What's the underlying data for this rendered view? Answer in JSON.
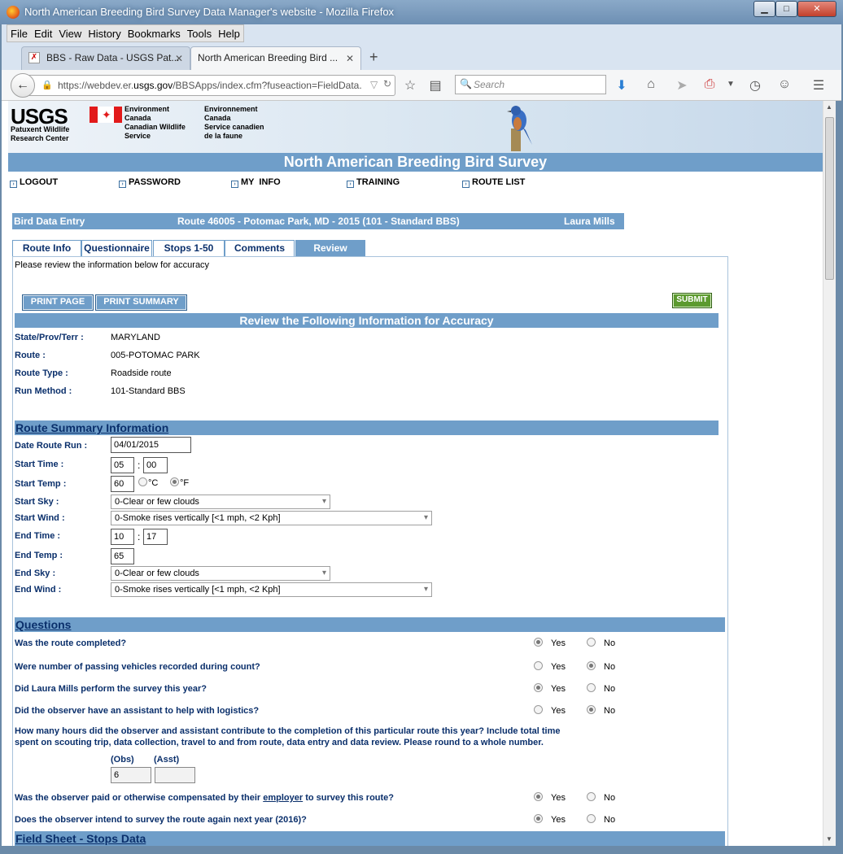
{
  "window": {
    "title": "North American Breeding Bird Survey Data Manager's website - Mozilla Firefox",
    "minimize": "▁",
    "maximize": "□",
    "close": "✕"
  },
  "menu": [
    "File",
    "Edit",
    "View",
    "History",
    "Bookmarks",
    "Tools",
    "Help"
  ],
  "tabs": [
    {
      "label": "BBS - Raw Data - USGS Pat...",
      "close": "✕"
    },
    {
      "label": "North American Breeding Bird ...",
      "close": "✕"
    }
  ],
  "new_tab": "+",
  "nav": {
    "url_prefix": "https://webdev.er.",
    "url_domain": "usgs.gov",
    "url_rest": "/BBSApps/index.cfm?fuseaction=FieldData.",
    "search_placeholder": "Search",
    "icons": [
      "back-icon",
      "lock-icon",
      "reload-icon",
      "bookmark-star-icon",
      "reading-list-icon",
      "search-icon",
      "download-icon",
      "home-icon",
      "send-icon",
      "pdf-icon",
      "menu-dropdown-icon",
      "history-icon",
      "feedback-icon",
      "hamburger-menu-icon"
    ]
  },
  "header": {
    "usgs": "USGS",
    "usgs_sub": [
      "Patuxent Wildlife",
      "Research Center"
    ],
    "ec_en": [
      "Environment",
      "Canada",
      "Canadian Wildlife",
      "Service"
    ],
    "ec_fr": [
      "Environnement",
      "Canada",
      "Service canadien",
      "de la faune"
    ],
    "title": "North American Breeding Bird Survey"
  },
  "topnav": [
    "LOGOUT",
    "PASSWORD",
    "MY  INFO",
    "TRAINING",
    "ROUTE LIST"
  ],
  "entry": {
    "label": "Bird Data Entry",
    "route": "Route 46005 - Potomac Park, MD - 2015 (101 - Standard BBS)",
    "observer": "Laura Mills"
  },
  "page_tabs": [
    "Route Info",
    "Questionnaire",
    "Stops 1-50",
    "Comments",
    "Review"
  ],
  "intro": "Please review the information below for accuracy",
  "buttons": {
    "print_page": "PRINT PAGE",
    "print_summary": "PRINT SUMMARY",
    "submit": "SUBMIT"
  },
  "review_header": "Review the Following Information for Accuracy",
  "route_info": [
    {
      "label": "State/Prov/Terr :",
      "value": "MARYLAND"
    },
    {
      "label": "Route :",
      "value": "005-POTOMAC PARK"
    },
    {
      "label": "Route Type :",
      "value": "Roadside route"
    },
    {
      "label": "Run Method :",
      "value": "101-Standard BBS"
    }
  ],
  "summary_header": "Route Summary Information",
  "summary": {
    "date_label": "Date Route Run :",
    "date": "04/01/2015",
    "start_time_label": "Start Time :",
    "start_hh": "05",
    "start_mm": "00",
    "start_temp_label": "Start Temp :",
    "start_temp": "60",
    "unit_c": "°C",
    "unit_f": "°F",
    "start_sky_label": "Start Sky :",
    "start_sky": "0-Clear or few clouds",
    "start_wind_label": "Start Wind :",
    "start_wind": "0-Smoke rises vertically [<1 mph, <2 Kph]",
    "end_time_label": "End Time :",
    "end_hh": "10",
    "end_mm": "17",
    "end_temp_label": "End Temp :",
    "end_temp": "65",
    "end_sky_label": "End Sky :",
    "end_sky": "0-Clear or few clouds",
    "end_wind_label": "End Wind :",
    "end_wind": "0-Smoke rises vertically [<1 mph, <2 Kph]",
    "colon": ":"
  },
  "questions_header": "Questions",
  "questions": [
    {
      "text": "Was the route completed?",
      "answer": "Yes"
    },
    {
      "text": "Were number of passing vehicles recorded during count?",
      "answer": "No"
    },
    {
      "text": "Did Laura Mills perform the survey this year?",
      "answer": "Yes"
    },
    {
      "text": "Did the observer have an assistant to help with logistics?",
      "answer": "No"
    }
  ],
  "hours_q": {
    "line1": "How many hours did the observer and assistant contribute to the completion of this particular route this year? Include total time",
    "line2": "spent on scouting trip, data collection, travel to and from route, data entry and data review. Please round to a whole number.",
    "obs_label": "(Obs)",
    "asst_label": "(Asst)",
    "obs": "6",
    "asst": ""
  },
  "q_paid": {
    "before": "Was the observer paid or otherwise compensated by their ",
    "link": "employer",
    "after": " to survey this route?",
    "answer": "Yes"
  },
  "q_next": {
    "text": "Does the observer intend to survey the route again next year (2016)?",
    "answer": "Yes"
  },
  "yes": "Yes",
  "no": "No",
  "field_sheet_header": "Field Sheet - Stops Data"
}
